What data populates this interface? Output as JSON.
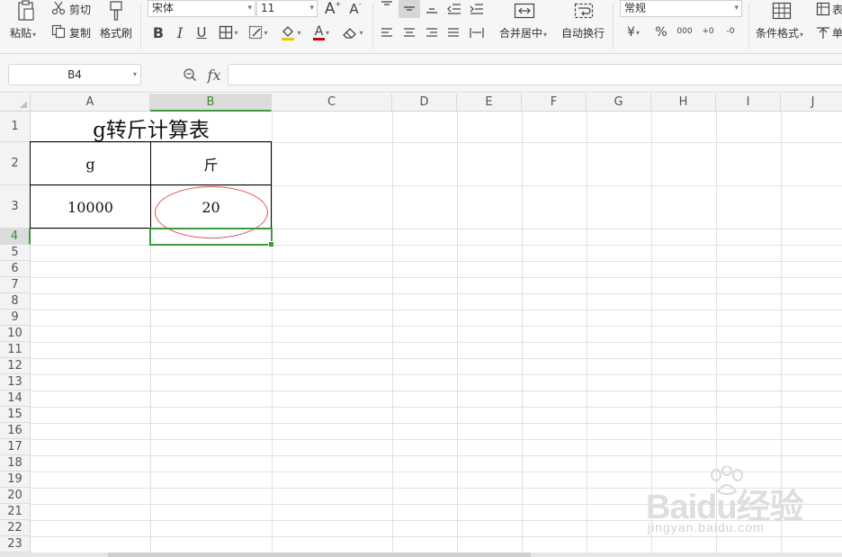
{
  "ribbon": {
    "paste_label": "粘贴",
    "cut_label": "剪切",
    "copy_label": "复制",
    "format_painter_label": "格式刷",
    "font_name": "宋体",
    "font_size": "11",
    "grow_font": "A",
    "shrink_font": "A",
    "bold": "B",
    "italic": "I",
    "underline": "U",
    "font_color_glyph": "A",
    "merge_center_label": "合并居中",
    "wrap_text_label": "自动换行",
    "number_format": "常规",
    "currency_glyph": "¥",
    "percent_glyph": "%",
    "thousands_glyph": "000",
    "inc_decimal_glyph": "+0",
    "dec_decimal_glyph": "-0",
    "conditional_format_label": "条件格式",
    "table_style_label": "表",
    "cell_label": "单"
  },
  "formula_bar": {
    "name_box": "B4",
    "fx_label": "fx",
    "formula": ""
  },
  "grid": {
    "columns": [
      "A",
      "B",
      "C",
      "D",
      "E",
      "F",
      "G",
      "H",
      "I",
      "J"
    ],
    "rows": [
      "1",
      "2",
      "3",
      "4",
      "5",
      "6",
      "7",
      "8",
      "9",
      "10",
      "11",
      "12",
      "13",
      "14",
      "15",
      "16",
      "17",
      "18",
      "19",
      "20",
      "21",
      "22",
      "23"
    ],
    "selected_column": "B",
    "selected_row": "4",
    "cells": {
      "title": "g转斤计算表",
      "a2": "g",
      "b2": "斤",
      "a3": "10000",
      "b3": "20"
    }
  },
  "colors": {
    "accent": "#3d9b3d",
    "annotation": "#e05858"
  },
  "watermark": {
    "brand": "Baidu经验",
    "url": "jingyan.baidu.com"
  }
}
